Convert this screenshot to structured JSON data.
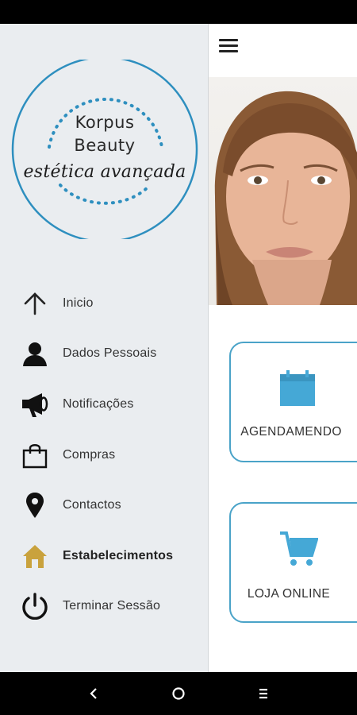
{
  "logo": {
    "line1": "Korpus",
    "line2": "Beauty",
    "tagline": "estética avançada",
    "accent_color": "#2e8fbf"
  },
  "drawer": {
    "items": [
      {
        "label": "Inicio",
        "icon": "arrow-up-icon"
      },
      {
        "label": "Dados Pessoais",
        "icon": "person-icon"
      },
      {
        "label": "Notificações",
        "icon": "megaphone-icon"
      },
      {
        "label": "Compras",
        "icon": "shopping-bag-icon"
      },
      {
        "label": "Contactos",
        "icon": "location-pin-icon"
      },
      {
        "label": "Estabelecimentos",
        "icon": "home-icon",
        "active": true
      },
      {
        "label": "Terminar Sessão",
        "icon": "power-icon"
      }
    ]
  },
  "main": {
    "menu_icon": "hamburger-menu-icon",
    "cards": [
      {
        "label": "AGENDAMENDO",
        "icon": "calendar-icon"
      },
      {
        "label": "LOJA ONLINE",
        "icon": "shopping-cart-icon"
      }
    ]
  },
  "colors": {
    "card_border": "#4aa3c8",
    "icon_blue": "#45a8d6",
    "active_home": "#c9a23d",
    "drawer_bg": "#eaedf0"
  },
  "system_nav": {
    "buttons": [
      "back-icon",
      "home-circle-icon",
      "recents-icon"
    ]
  }
}
